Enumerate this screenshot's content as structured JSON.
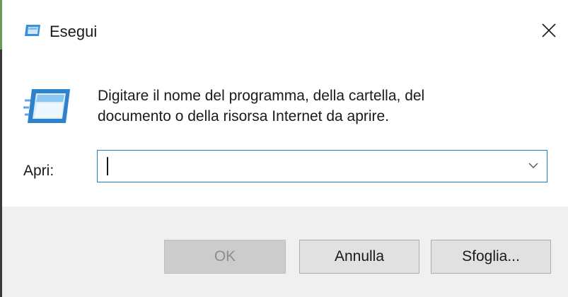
{
  "window": {
    "title": "Esegui",
    "icon": "run-icon",
    "close_icon": "close-icon"
  },
  "dialog": {
    "description": "Digitare il nome del programma, della cartella, del documento o della risorsa Internet da aprire.",
    "icon": "run-program-icon",
    "open_label": "Apri:",
    "open_value": "",
    "dropdown_icon": "chevron-down-icon"
  },
  "buttons": {
    "ok_label": "OK",
    "ok_enabled": false,
    "cancel_label": "Annulla",
    "browse_label": "Sfoglia..."
  },
  "colors": {
    "accent": "#1a7fc9",
    "footer_bg": "#f0f0f0",
    "disabled_text": "#8c8c8c"
  }
}
